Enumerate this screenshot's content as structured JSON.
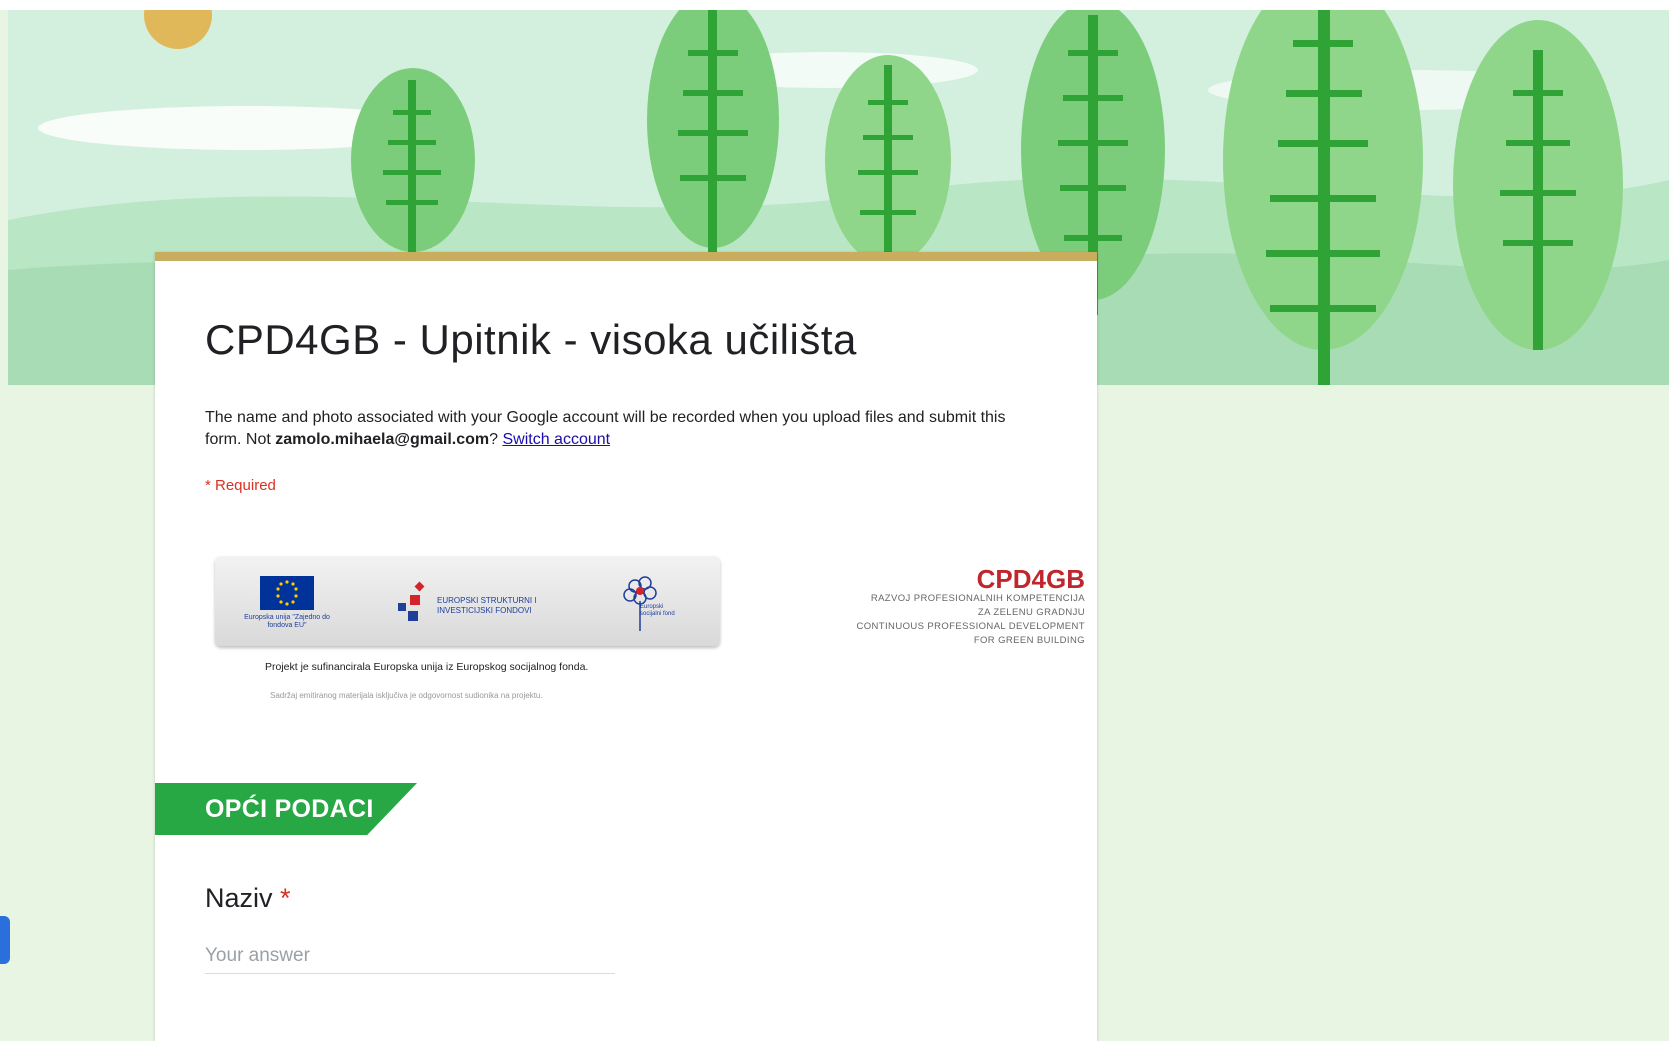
{
  "form": {
    "title": "CPD4GB - Upitnik - visoka učilišta",
    "notice_prefix": "The name and photo associated with your Google account will be recorded when you upload files and submit this form. Not ",
    "email": "zamolo.mihaela@gmail.com",
    "notice_suffix": "? ",
    "switch_account": "Switch account",
    "required_note": "* Required"
  },
  "banner": {
    "eu_caption": "Europska unija \"Zajedno do fondova EU\"",
    "esif_text": "EUROPSKI STRUKTURNI I INVESTICIJSKI FONDOVI",
    "esf_text": "Europski socijalni fond",
    "cofinance": "Projekt je sufinancirala Europska unija iz Europskog socijalnog fonda.",
    "disclaimer": "Sadržaj emitiranog materijala isključiva je odgovornost sudionika na projektu.",
    "cpd_name": "CPD4GB",
    "cpd_lines": [
      "RAZVOJ PROFESIONALNIH KOMPETENCIJA",
      "ZA ZELENU GRADNJU",
      "CONTINUOUS PROFESSIONAL DEVELOPMENT",
      "FOR GREEN BUILDING"
    ]
  },
  "section": {
    "title": "OPĆI PODACI"
  },
  "question": {
    "label": "Naziv",
    "required_mark": "*",
    "placeholder": "Your answer"
  },
  "colors": {
    "accent_gold": "#c9ad5e",
    "section_green": "#28a745",
    "required_red": "#d93025",
    "page_bg": "#e8f5e2"
  }
}
